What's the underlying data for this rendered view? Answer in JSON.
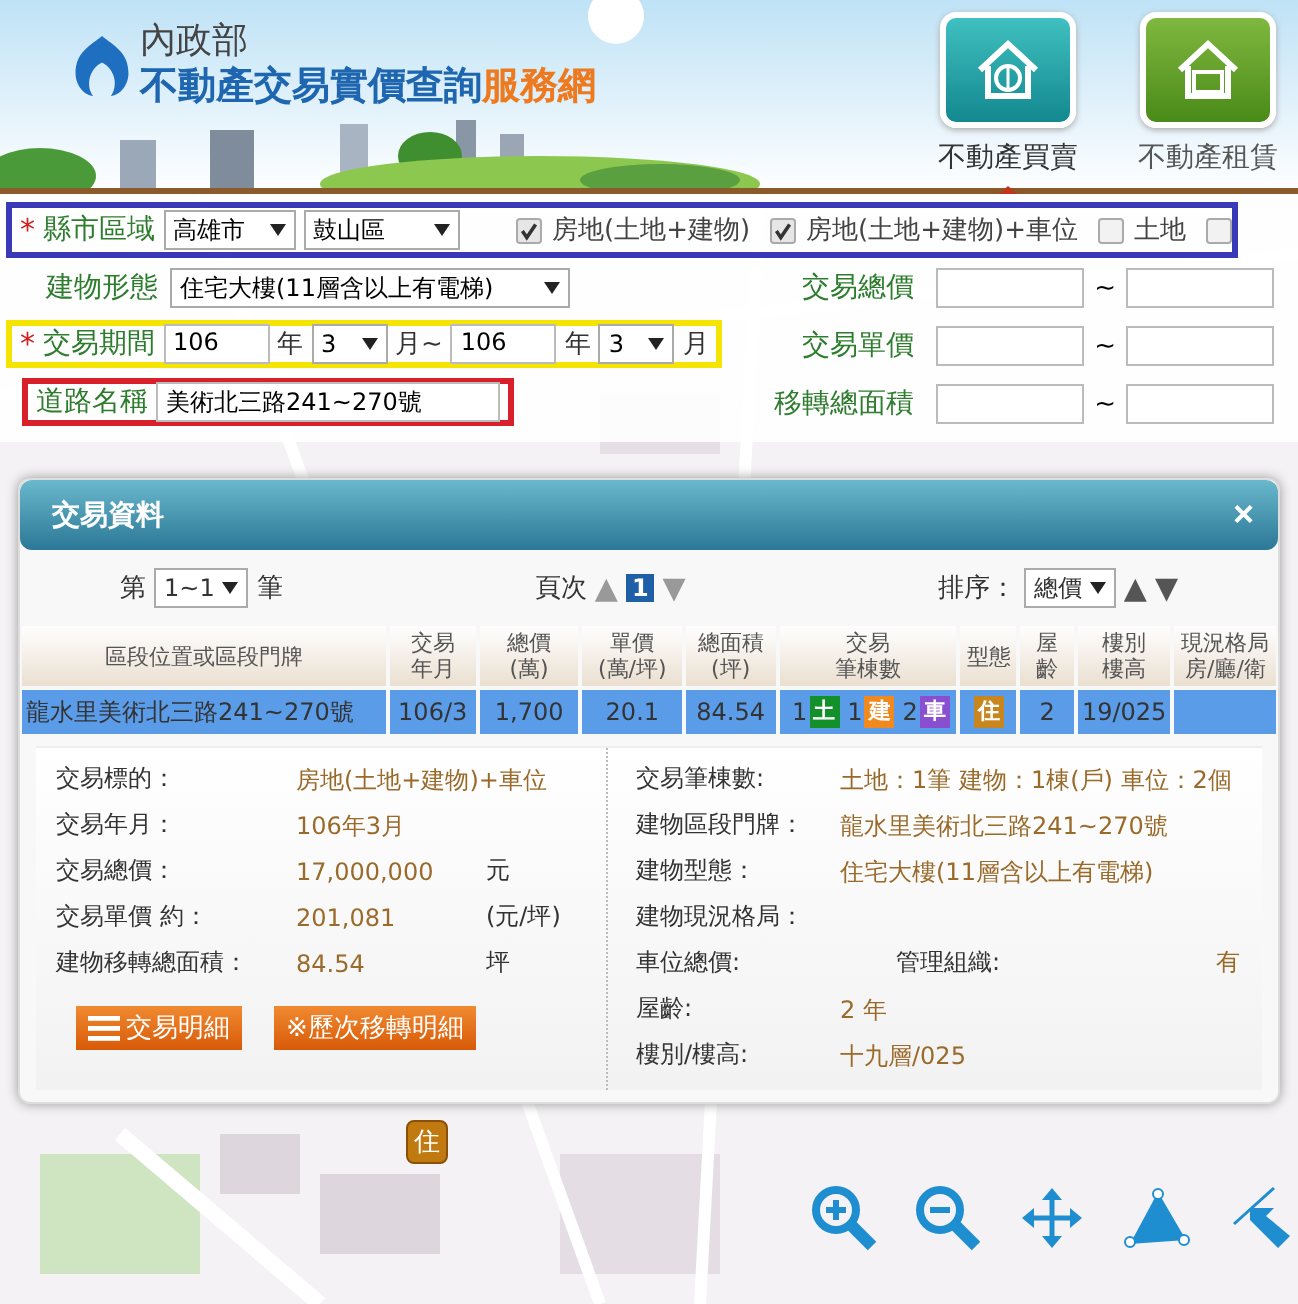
{
  "header": {
    "ministry": "內政部",
    "title_main": "不動產交易實價查詢",
    "title_accent": "服務網",
    "nav": [
      {
        "label": "不動產買賣",
        "kind": "sale",
        "selected": true
      },
      {
        "label": "不動產租賃",
        "kind": "rent",
        "selected": false
      }
    ]
  },
  "search": {
    "city_row": {
      "required": "*",
      "label": "縣市區域",
      "city": "高雄市",
      "district": "鼓山區",
      "options": [
        {
          "label": "房地(土地+建物)",
          "checked": true
        },
        {
          "label": "房地(土地+建物)+車位",
          "checked": true
        },
        {
          "label": "土地",
          "checked": false
        },
        {
          "checked": false
        }
      ]
    },
    "building_type": {
      "label": "建物形態",
      "value": "住宅大樓(11層含以上有電梯)"
    },
    "period": {
      "required": "*",
      "label": "交易期間",
      "from_year": "106",
      "from_year_unit": "年",
      "from_month": "3",
      "from_month_unit": "月~",
      "to_year": "106",
      "to_year_unit": "年",
      "to_month": "3",
      "to_month_unit": "月"
    },
    "road": {
      "label": "道路名稱",
      "value": "美術北三路241~270號"
    },
    "ranges": [
      {
        "label": "交易總價",
        "separator": "~"
      },
      {
        "label": "交易單價",
        "separator": "~"
      },
      {
        "label": "移轉總面積",
        "separator": "~"
      }
    ]
  },
  "popup": {
    "title": "交易資料",
    "close": "×",
    "pager": {
      "prefix": "第",
      "range": "1~1",
      "suffix": "筆",
      "page_label": "頁次",
      "prev": "▲",
      "page": "1",
      "next": "▼",
      "sort_label": "排序：",
      "sort": "總價",
      "sort_up": "▲",
      "sort_down": "▼"
    },
    "columns": [
      [
        "區段位置或區段門牌"
      ],
      [
        "交易",
        "年月"
      ],
      [
        "總價",
        "(萬)"
      ],
      [
        "單價",
        "(萬/坪)"
      ],
      [
        "總面積",
        "(坪)"
      ],
      [
        "交易",
        "筆棟數"
      ],
      [
        "型態"
      ],
      [
        "屋",
        "齡"
      ],
      [
        "樓別",
        "樓高"
      ],
      [
        "現況格局",
        "房/廳/衛"
      ]
    ],
    "rows": [
      {
        "selected": true,
        "address": "龍水里美術北三路241~270號",
        "date": "106/3",
        "total": "1,700",
        "unit_price": "20.1",
        "area": "84.54",
        "counts": [
          {
            "number": "1",
            "tag": "土",
            "color": "#14902a"
          },
          {
            "number": "1",
            "tag": "建",
            "color": "#f08a1e"
          },
          {
            "number": "2",
            "tag": "車",
            "color": "#8a4fd0"
          }
        ],
        "type": "住",
        "age": "2",
        "floor": "19/025"
      }
    ],
    "details_left": [
      {
        "label": "交易標的：",
        "value": "房地(土地+建物)+車位"
      },
      {
        "label": "交易年月：",
        "value": "106年3月"
      },
      {
        "label": "交易總價：",
        "value": "17,000,000",
        "unit": "元"
      },
      {
        "label": "交易單價 約：",
        "value": "201,081",
        "unit": "(元/坪)"
      },
      {
        "label": "建物移轉總面積：",
        "value": "84.54",
        "unit": "坪"
      }
    ],
    "buttons": [
      {
        "label": "交易明細",
        "kind": "menu"
      },
      {
        "label": "※歷次移轉明細",
        "kind": "plain"
      }
    ],
    "details_right": [
      {
        "label": "交易筆棟數:",
        "value": "土地：1筆 建物：1棟(戶) 車位：2個"
      },
      {
        "label": "建物區段門牌：",
        "value": "龍水里美術北三路241~270號"
      },
      {
        "label": "建物型態：",
        "value": "住宅大樓(11層含以上有電梯)"
      },
      {
        "label": "建物現況格局："
      },
      {
        "label": "車位總價:",
        "extra_label": "管理組織:",
        "extra_value": "有"
      },
      {
        "label": "屋齡:",
        "value": "2 年"
      },
      {
        "label": "樓別/樓高:",
        "value": "十九層/025"
      }
    ]
  },
  "map": {
    "marker": "住",
    "tools": [
      {
        "kind": "zoom-in"
      },
      {
        "kind": "zoom-out"
      },
      {
        "kind": "pan"
      },
      {
        "kind": "area"
      },
      {
        "kind": "measure"
      }
    ]
  }
}
